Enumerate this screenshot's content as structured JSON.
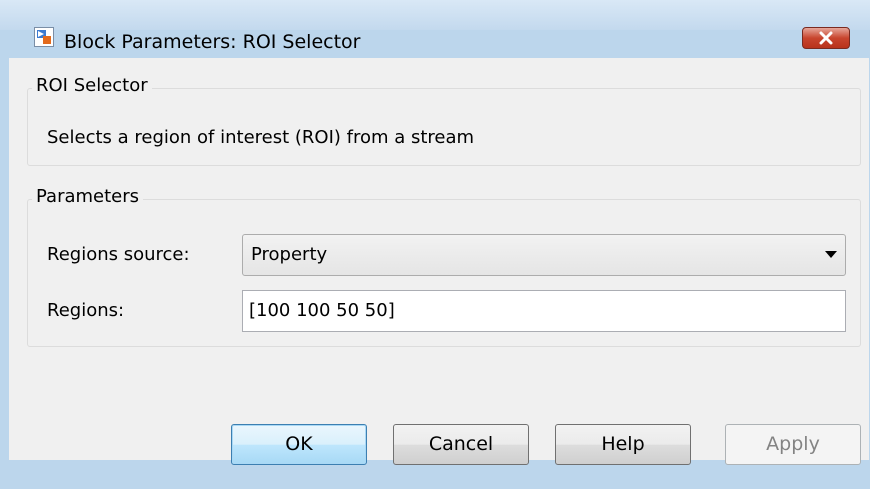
{
  "window": {
    "title": "Block Parameters: ROI Selector",
    "icon": "simulink-block-icon",
    "close_icon": "close-icon"
  },
  "description_group": {
    "legend": "ROI Selector",
    "text": "Selects a region of interest (ROI) from a stream"
  },
  "parameters_group": {
    "legend": "Parameters",
    "regions_source": {
      "label": "Regions source:",
      "value": "Property"
    },
    "regions": {
      "label": "Regions:",
      "value": "[100 100 50 50]"
    }
  },
  "buttons": {
    "ok": "OK",
    "cancel": "Cancel",
    "help": "Help",
    "apply": "Apply"
  },
  "colors": {
    "close_button": "#c8452e",
    "dialog_background": "#f0f0f0",
    "frame": "#bcd6ec"
  }
}
